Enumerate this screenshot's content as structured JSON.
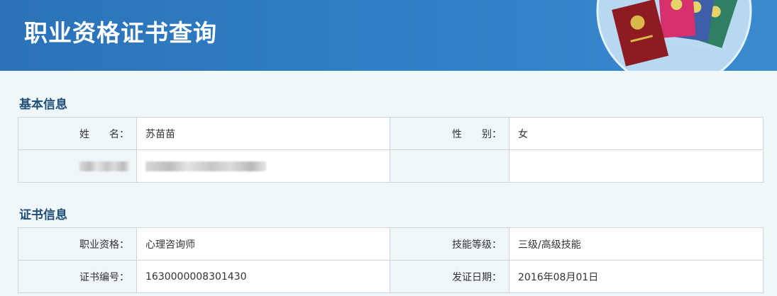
{
  "header": {
    "title": "职业资格证书查询"
  },
  "basic_info": {
    "section_title": "基本信息",
    "name_label": "姓　　名：",
    "name_value": "苏苗苗",
    "gender_label": "性　　别：",
    "gender_value": "女"
  },
  "certificate_info": {
    "section_title": "证书信息",
    "qualification_label": "职业资格：",
    "qualification_value": "心理咨询师",
    "skill_level_label": "技能等级：",
    "skill_level_value": "三级/高级技能",
    "cert_no_label": "证书编号：",
    "cert_no_value": "1630000008301430",
    "issue_date_label": "发证日期：",
    "issue_date_value": "2016年08月01日"
  },
  "colors": {
    "header_blue": "#2f7bc2",
    "section_title": "#1f4e79",
    "label_bg": "#eef6f9",
    "page_bg": "#f0f7fa"
  }
}
